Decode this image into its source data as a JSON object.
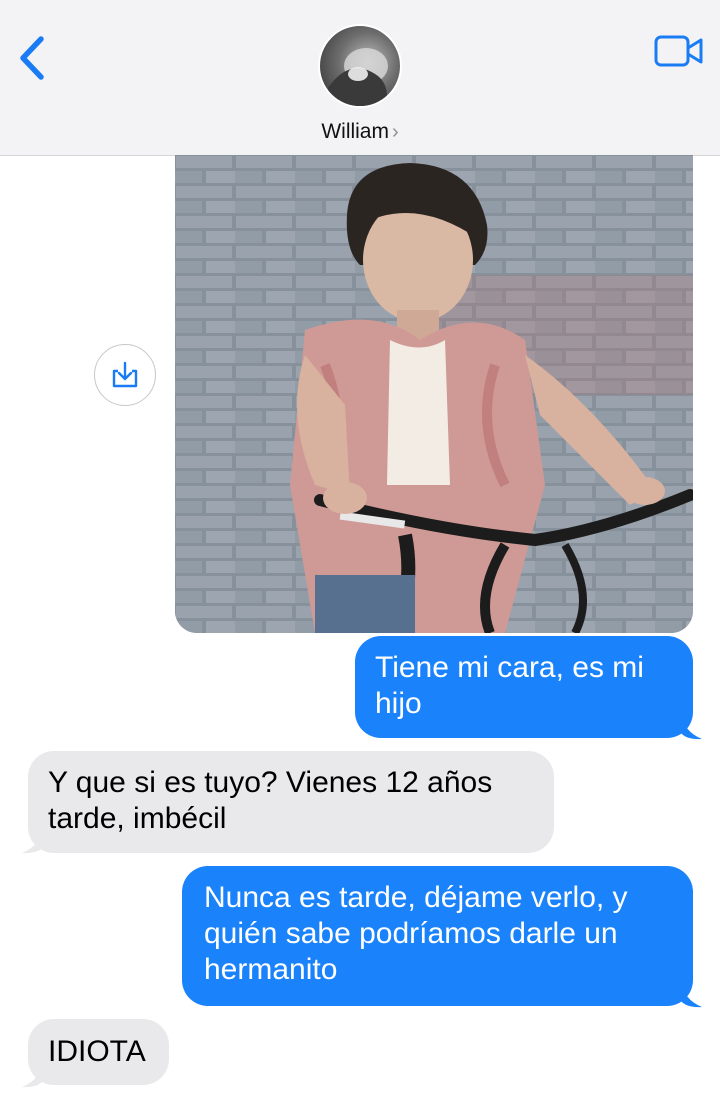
{
  "header": {
    "contact_name": "William",
    "chevron": "›",
    "back_icon": "chevron-left-icon",
    "video_icon": "video-camera-icon"
  },
  "colors": {
    "outgoing_bubble": "#1a82fb",
    "incoming_bubble": "#e9e9eb",
    "accent": "#1a7cf5"
  },
  "photo": {
    "alt": "Foto"
  },
  "messages": [
    {
      "direction": "outgoing",
      "text": "Tiene mi cara, es mi hijo",
      "lines": [
        "Tiene mi cara, es mi",
        "hijo"
      ]
    },
    {
      "direction": "incoming",
      "text": "Y que si es tuyo? Vienes 12 años tarde, imbécil",
      "lines": [
        "Y que si es tuyo? Vienes 12 años",
        "tarde, imbécil"
      ]
    },
    {
      "direction": "outgoing",
      "text": "Nunca es tarde, déjame verlo, y quién sabe podríamos darle un hermanito",
      "lines": [
        "Nunca es tarde, déjame verlo, y",
        "quién sabe podríamos darle un",
        "hermanito"
      ]
    },
    {
      "direction": "incoming",
      "text": "IDIOTA",
      "lines": [
        "IDIOTA"
      ]
    }
  ]
}
